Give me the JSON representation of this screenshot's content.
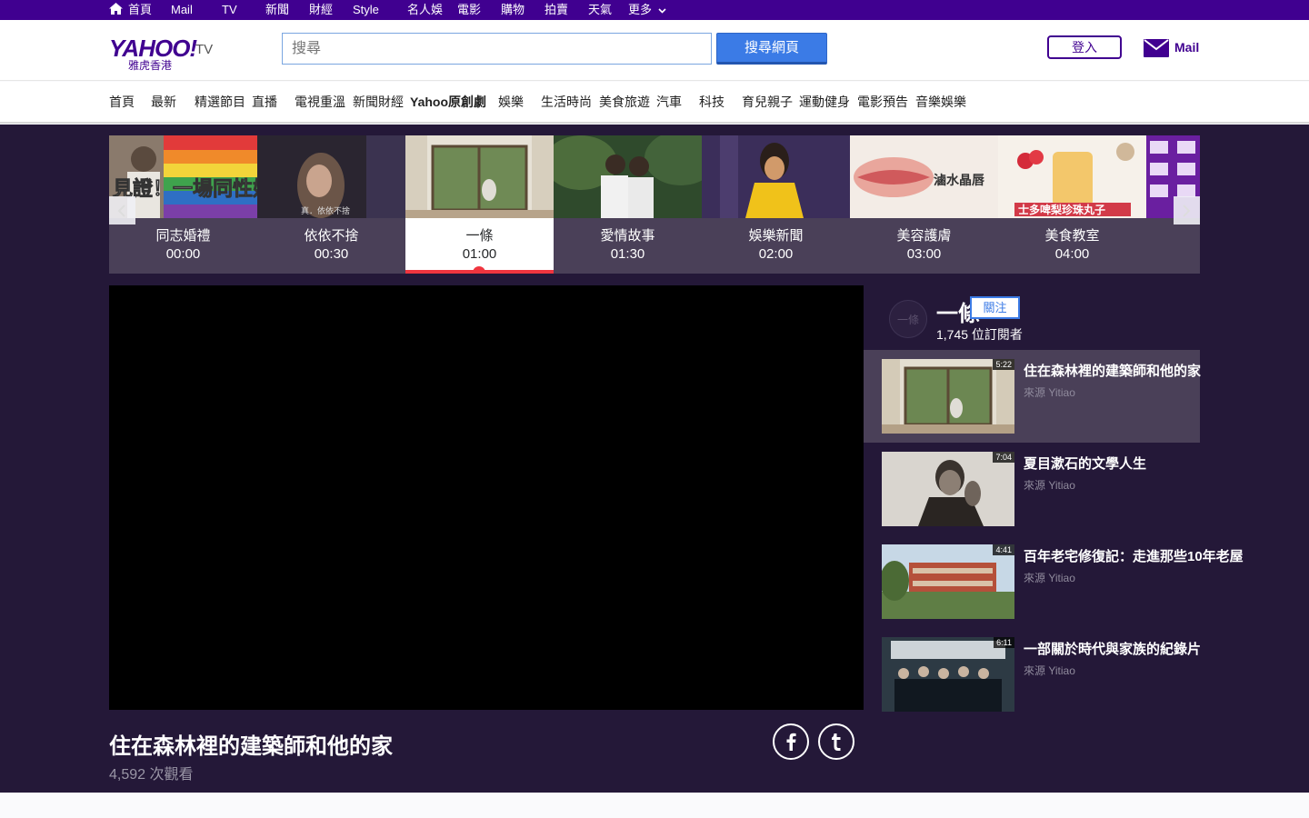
{
  "topbar": {
    "items": [
      "首頁",
      "Mail",
      "TV",
      "新聞",
      "財經",
      "Style",
      "名人娛",
      "電影",
      "購物",
      "拍賣",
      "天氣",
      "更多"
    ]
  },
  "header": {
    "logo_text": "YAHOO!",
    "logo_tv": "TV",
    "logo_sub": "雅虎香港",
    "search_placeholder": "搜尋",
    "search_button": "搜尋網頁",
    "login_button": "登入",
    "mail_label": "Mail"
  },
  "categories": [
    {
      "label": "首頁",
      "bold": false
    },
    {
      "label": "最新",
      "bold": false
    },
    {
      "label": "精選節目",
      "bold": false
    },
    {
      "label": "直播",
      "bold": false
    },
    {
      "label": "電視重溫",
      "bold": false
    },
    {
      "label": "新聞財經",
      "bold": false
    },
    {
      "label": "Yahoo原創劇",
      "bold": true
    },
    {
      "label": "娛樂",
      "bold": false
    },
    {
      "label": "生活時尚",
      "bold": false
    },
    {
      "label": "美食旅遊",
      "bold": false
    },
    {
      "label": "汽車",
      "bold": false
    },
    {
      "label": "科技",
      "bold": false
    },
    {
      "label": "育兒親子",
      "bold": false
    },
    {
      "label": "運動健身",
      "bold": false
    },
    {
      "label": "電影預告",
      "bold": false
    },
    {
      "label": "音樂娛樂",
      "bold": false
    }
  ],
  "schedule": [
    {
      "title": "同志婚禮",
      "time": "00:00"
    },
    {
      "title": "依依不捨",
      "time": "00:30"
    },
    {
      "title": "一條",
      "time": "01:00"
    },
    {
      "title": "愛情故事",
      "time": "01:30"
    },
    {
      "title": "娛樂新聞",
      "time": "02:00"
    },
    {
      "title": "美容護膚",
      "time": "03:00"
    },
    {
      "title": "美食教室",
      "time": "04:00"
    }
  ],
  "thumb_captions": {
    "slot0": "見證！一場同性婚禮",
    "slot1": "真．依依不捨",
    "slot5": "滷水晶唇",
    "slot6": "士多啤梨珍珠丸子"
  },
  "video": {
    "title": "住在森林裡的建築師和他的家",
    "views": "4,592 次觀看"
  },
  "channel": {
    "avatar_text": "一條",
    "name": "一條",
    "follow_button": "關注",
    "subscribers": "1,745 位訂閱者"
  },
  "related_videos": [
    {
      "title": "住在森林裡的建築師和他的家",
      "source": "來源 Yitiao",
      "duration": "5:22"
    },
    {
      "title": "夏目漱石的文學人生",
      "source": "來源 Yitiao",
      "duration": "7:04"
    },
    {
      "title": "百年老宅修復記：走進那些10年老屋",
      "source": "來源 Yitiao",
      "duration": "4:41"
    },
    {
      "title": "一部關於時代與家族的紀錄片",
      "source": "來源 Yitiao",
      "duration": "6:11"
    }
  ],
  "colors": {
    "brand_purple": "#400090",
    "main_bg": "#241838",
    "accent_red": "#f0353f",
    "search_blue": "#3b7be6"
  }
}
